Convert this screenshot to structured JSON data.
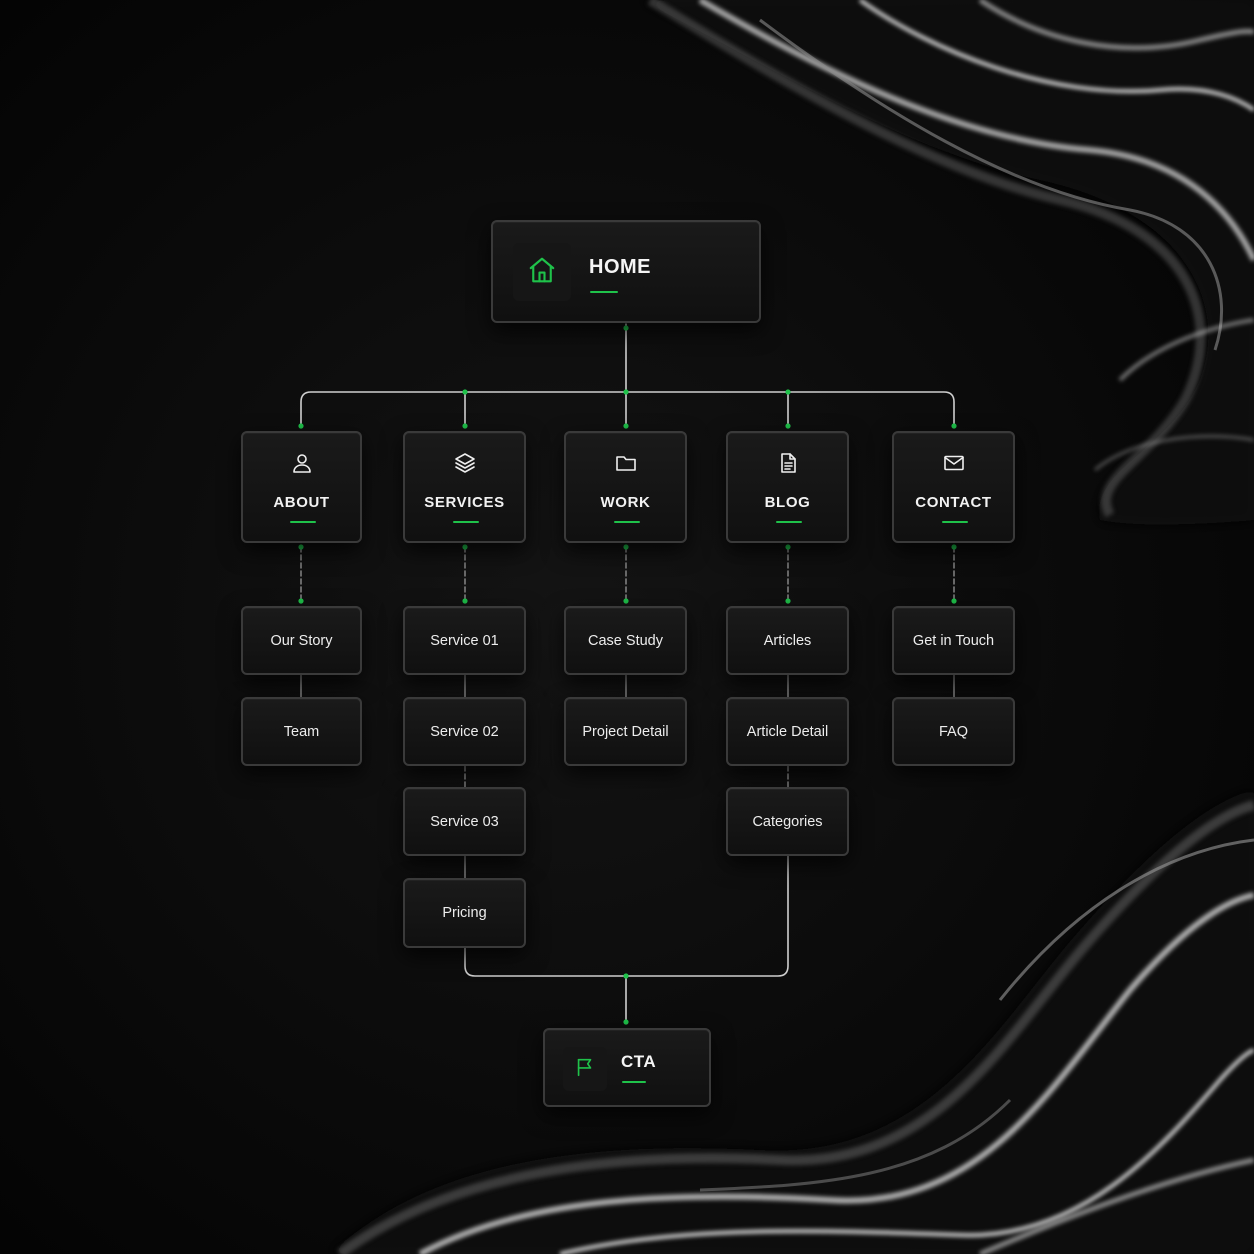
{
  "colors": {
    "background": "#050505",
    "node_fill": "#141414",
    "node_border": "#3a3a3a",
    "accent_green": "#1fc24a",
    "connector": "#cfcfcf"
  },
  "root": {
    "label": "HOME",
    "icon": "home-icon"
  },
  "sections": [
    {
      "id": "about",
      "label": "ABOUT",
      "icon": "user-icon",
      "pages": [
        "Our Story",
        "Team"
      ]
    },
    {
      "id": "services",
      "label": "SERVICES",
      "icon": "layers-icon",
      "pages": [
        "Service 01",
        "Service 02",
        "Service 03",
        "Pricing"
      ]
    },
    {
      "id": "work",
      "label": "WORK",
      "icon": "folder-icon",
      "pages": [
        "Case Study",
        "Project Detail"
      ]
    },
    {
      "id": "blog",
      "label": "BLOG",
      "icon": "document-icon",
      "pages": [
        "Articles",
        "Article Detail",
        "Categories"
      ]
    },
    {
      "id": "contact",
      "label": "CONTACT",
      "icon": "mail-icon",
      "pages": [
        "Get in Touch",
        "FAQ"
      ]
    }
  ],
  "cta": {
    "label": "CTA",
    "icon": "flag-icon"
  }
}
